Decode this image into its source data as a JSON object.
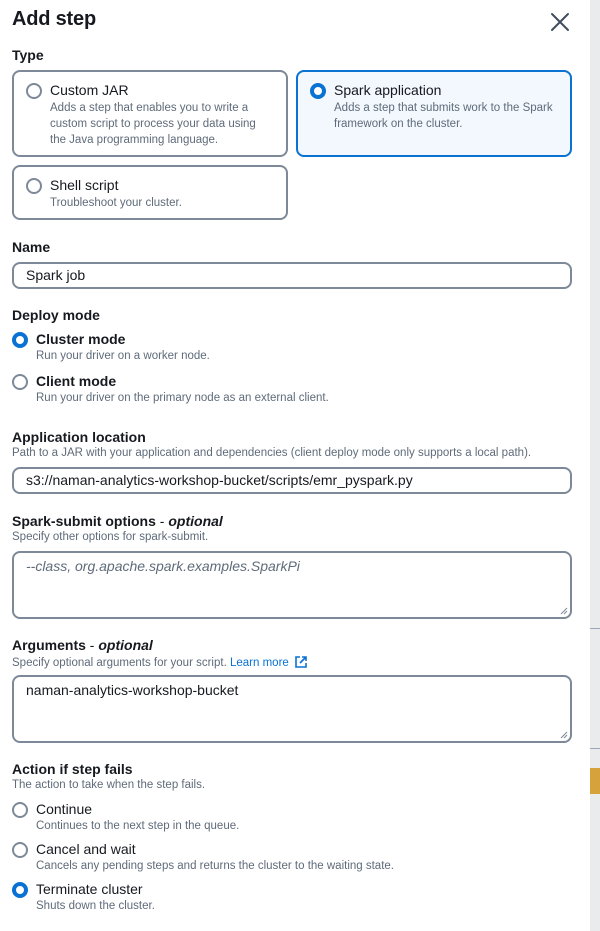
{
  "dialog": {
    "title": "Add step",
    "close_icon": "close-icon"
  },
  "type": {
    "label": "Type",
    "options": [
      {
        "title": "Custom JAR",
        "desc": "Adds a step that enables you to write a custom script to process your data using the Java programming language.",
        "selected": false
      },
      {
        "title": "Spark application",
        "desc": "Adds a step that submits work to the Spark framework on the cluster.",
        "selected": true
      },
      {
        "title": "Shell script",
        "desc": "Troubleshoot your cluster.",
        "selected": false
      }
    ]
  },
  "name": {
    "label": "Name",
    "value": "Spark job"
  },
  "deploy_mode": {
    "label": "Deploy mode",
    "options": [
      {
        "title": "Cluster mode",
        "desc": "Run your driver on a worker node.",
        "selected": true
      },
      {
        "title": "Client mode",
        "desc": "Run your driver on the primary node as an external client.",
        "selected": false
      }
    ]
  },
  "app_location": {
    "label": "Application location",
    "desc": "Path to a JAR with your application and dependencies (client deploy mode only supports a local path).",
    "value": "s3://naman-analytics-workshop-bucket/scripts/emr_pyspark.py"
  },
  "spark_submit": {
    "label": "Spark-submit options",
    "label_suffix": "optional",
    "sep": " - ",
    "desc": "Specify other options for spark-submit.",
    "placeholder": "--class, org.apache.spark.examples.SparkPi"
  },
  "arguments": {
    "label": "Arguments",
    "label_suffix": "optional",
    "sep": " - ",
    "desc": "Specify optional arguments for your script.",
    "learn_more": "Learn more",
    "value": "naman-analytics-workshop-bucket"
  },
  "action_on_failure": {
    "label": "Action if step fails",
    "desc": "The action to take when the step fails.",
    "options": [
      {
        "title": "Continue",
        "desc": "Continues to the next step in the queue.",
        "selected": false
      },
      {
        "title": "Cancel and wait",
        "desc": "Cancels any pending steps and returns the cluster to the waiting state.",
        "selected": false
      },
      {
        "title": "Terminate cluster",
        "desc": "Shuts down the cluster.",
        "selected": true
      }
    ]
  },
  "colors": {
    "accent": "#0972d3",
    "border": "#7d8998",
    "text_secondary": "#5f6b7a",
    "selected_bg": "#f2f8fd"
  }
}
